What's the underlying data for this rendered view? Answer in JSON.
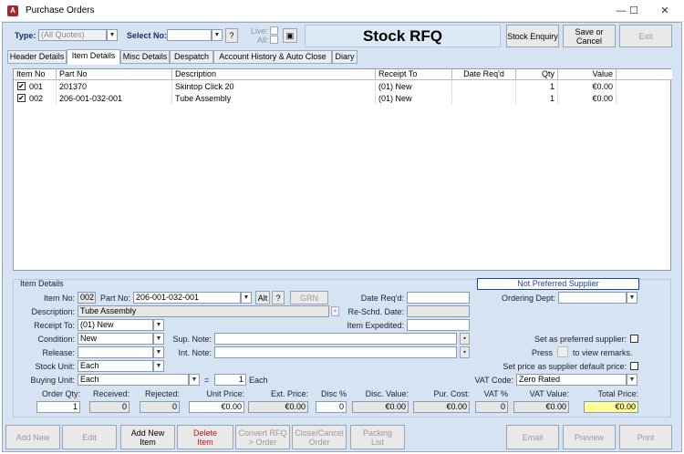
{
  "window": {
    "title": "Purchase Orders",
    "app_icon": "A",
    "minimize": "—",
    "maximize": "☐",
    "close": "✕"
  },
  "header": {
    "type_label": "Type:",
    "type_value": "(All Quotes)",
    "select_no_label": "Select No:",
    "select_no_value": "",
    "help_button": "?",
    "live_label": "Live:",
    "all_label": "All:",
    "form_title": "Stock RFQ",
    "stock_enquiry_button": "Stock Enquiry",
    "save_cancel_button": "Save or Cancel",
    "exit_button": "Exit"
  },
  "tabs": [
    "Header Details",
    "Item Details",
    "Misc Details",
    "Despatch",
    "Account History & Auto Close",
    "Diary"
  ],
  "grid": {
    "columns": [
      "Item No",
      "Part No",
      "Description",
      "Receipt To",
      "Date Req'd",
      "Qty",
      "Value"
    ],
    "rows": [
      {
        "checked": "✔",
        "item_no": "001",
        "part_no": "201370",
        "description": "Skintop Click 20",
        "receipt_to": "(01) New",
        "date_reqd": "",
        "qty": "1",
        "value": "€0.00"
      },
      {
        "checked": "✔",
        "item_no": "002",
        "part_no": "206-001-032-001",
        "description": "Tube Assembly",
        "receipt_to": "(01) New",
        "date_reqd": "",
        "qty": "1",
        "value": "€0.00"
      }
    ]
  },
  "item_details": {
    "section_label": "Item Details",
    "not_preferred": "Not Preferred Supplier",
    "item_no_label": "Item No:",
    "item_no": "002",
    "part_no_label": "Part No:",
    "part_no": "206-001-032-001",
    "alt_button": "Alt",
    "help_button": "?",
    "grn_button": "GRN",
    "date_reqd_label": "Date Req'd:",
    "date_reqd": "",
    "ordering_dept_label": "Ordering Dept:",
    "ordering_dept": "",
    "description_label": "Description:",
    "description": "Tube Assembly",
    "reschd_label": "Re-Schd. Date:",
    "reschd": "",
    "receipt_to_label": "Receipt To:",
    "receipt_to": "(01) New",
    "item_expedited_label": "Item Expedited:",
    "item_expedited": "",
    "condition_label": "Condition:",
    "condition": "New",
    "sup_note_label": "Sup. Note:",
    "sup_note": "",
    "set_pref_label": "Set as preferred supplier:",
    "release_label": "Release:",
    "release": "",
    "int_note_label": "Int. Note:",
    "int_note": "",
    "press_label": "Press",
    "view_remarks_label": "to view remarks.",
    "stock_unit_label": "Stock Unit:",
    "stock_unit": "Each",
    "set_price_label": "Set price as supplier default price:",
    "buying_unit_label": "Buying Unit:",
    "buying_unit": "Each",
    "equals": "=",
    "conversion": "1",
    "conversion_unit": "Each",
    "vat_code_label": "VAT Code:",
    "vat_code": "Zero Rated",
    "totals_labels": [
      "Order Qty:",
      "Received:",
      "Rejected:",
      "Unit Price:",
      "Ext. Price:",
      "Disc %",
      "Disc. Value:",
      "Pur. Cost:",
      "VAT %",
      "VAT Value:",
      "Total Price:"
    ],
    "totals_values": [
      "1",
      "0",
      "0",
      "€0.00",
      "€0.00",
      "0",
      "€0.00",
      "€0.00",
      "0",
      "€0.00",
      "€0.00"
    ]
  },
  "footer": {
    "add_new": "Add New",
    "edit": "Edit",
    "add_new_item": "Add New Item",
    "delete_item": "Delete Item",
    "convert": "Convert RFQ > Order",
    "close_cancel": "Close/Cancel Order",
    "packing_list": "Packing List",
    "email": "Email",
    "preview": "Preview",
    "print": "Print"
  }
}
